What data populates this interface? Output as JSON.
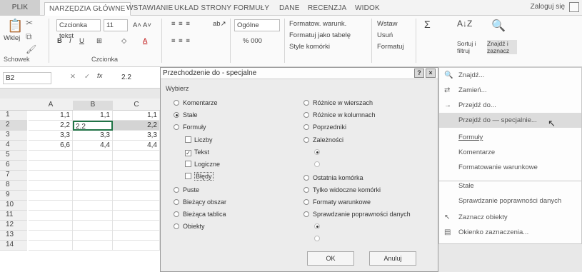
{
  "tabs": [
    {
      "label": "PLIK"
    },
    {
      "label": "NARZĘDZIA GŁÓWNE"
    },
    {
      "label": "WSTAWIANIE"
    },
    {
      "label": "UKŁAD STRONY"
    },
    {
      "label": "FORMUŁY"
    },
    {
      "label": "DANE"
    },
    {
      "label": "RECENZJA"
    },
    {
      "label": "WIDOK"
    }
  ],
  "login": "Zaloguj się",
  "ribbon": {
    "paste": "Wklej",
    "clipboard_group": "Schowek",
    "font_name": "Czcionka tekst",
    "font_size": "11",
    "font_group": "Czcionka",
    "number_format": "Ogólne",
    "percent": "% 000",
    "cond_format": "Formatow. warunk.",
    "format_table": "Formatuj jako tabelę",
    "cell_styles": "Style komórki",
    "insert": "Wstaw",
    "delete": "Usuń",
    "format": "Formatuj",
    "sort": "Sortuj i filtruj",
    "find": "Znajdź i zaznacz"
  },
  "formula_bar": {
    "name_box": "B2",
    "fx": "fx",
    "value": "2.2"
  },
  "grid": {
    "columns": [
      "A",
      "B",
      "C"
    ],
    "rows": [
      {
        "num": "1",
        "a": "1,1",
        "b": "1,1",
        "c": "1,1"
      },
      {
        "num": "2",
        "a": "2,2",
        "b": "2.2",
        "c": "2,2"
      },
      {
        "num": "3",
        "a": "3,3",
        "b": "3,3",
        "c": "3,3"
      },
      {
        "num": "4",
        "a": "6,6",
        "b": "4,4",
        "c": "4,4"
      },
      {
        "num": "5",
        "a": "",
        "b": "",
        "c": ""
      },
      {
        "num": "6",
        "a": "",
        "b": "",
        "c": ""
      },
      {
        "num": "7",
        "a": "",
        "b": "",
        "c": ""
      },
      {
        "num": "8",
        "a": "",
        "b": "",
        "c": ""
      },
      {
        "num": "9",
        "a": "",
        "b": "",
        "c": ""
      },
      {
        "num": "10",
        "a": "",
        "b": "",
        "c": ""
      },
      {
        "num": "11",
        "a": "",
        "b": "",
        "c": ""
      },
      {
        "num": "12",
        "a": "",
        "b": "",
        "c": ""
      },
      {
        "num": "13",
        "a": "",
        "b": "",
        "c": ""
      },
      {
        "num": "14",
        "a": "",
        "b": "",
        "c": ""
      }
    ]
  },
  "dialog": {
    "title": "Przechodzenie do - specjalne",
    "help": "?",
    "close": "×",
    "section": "Wybierz",
    "left_options": {
      "komentarze": "Komentarze",
      "stale": "Stałe",
      "formuly": "Formuły",
      "liczby": "Liczby",
      "tekst": "Tekst",
      "logiczne": "Logiczne",
      "bledy": "Błędy",
      "puste": "Puste",
      "biezacy_obszar": "Bieżący obszar",
      "biezaca_tablica": "Bieżąca tablica",
      "obiekty": "Obiekty"
    },
    "right_options": {
      "roznice_wiersze": "Różnice w wierszach",
      "roznice_kolumny": "Różnice w kolumnach",
      "poprzedniki": "Poprzedniki",
      "zaleznosci": "Zależności",
      "ostatnia": "Ostatnia komórka",
      "widoczne": "Tylko widoczne komórki",
      "formaty": "Formaty warunkowe",
      "sprawdzanie": "Sprawdzanie poprawności danych"
    },
    "ok": "OK",
    "cancel": "Anuluj"
  },
  "menu": {
    "items": [
      {
        "label": "Znajdź...",
        "icon": "binoculars-icon"
      },
      {
        "label": "Zamień...",
        "icon": "replace-icon"
      },
      {
        "label": "Przejdź do...",
        "icon": "arrow-right-icon"
      },
      {
        "label": "Przejdź do — specjalnie...",
        "icon": ""
      },
      {
        "label": "Formuły",
        "icon": ""
      },
      {
        "label": "Komentarze",
        "icon": ""
      },
      {
        "label": "Formatowanie warunkowe",
        "icon": ""
      },
      {
        "label": "Stałe",
        "icon": ""
      },
      {
        "label": "Sprawdzanie poprawności danych",
        "icon": ""
      },
      {
        "label": "Zaznacz obiekty",
        "icon": "cursor-icon"
      },
      {
        "label": "Okienko zaznaczenia...",
        "icon": "selection-pane-icon"
      }
    ]
  }
}
